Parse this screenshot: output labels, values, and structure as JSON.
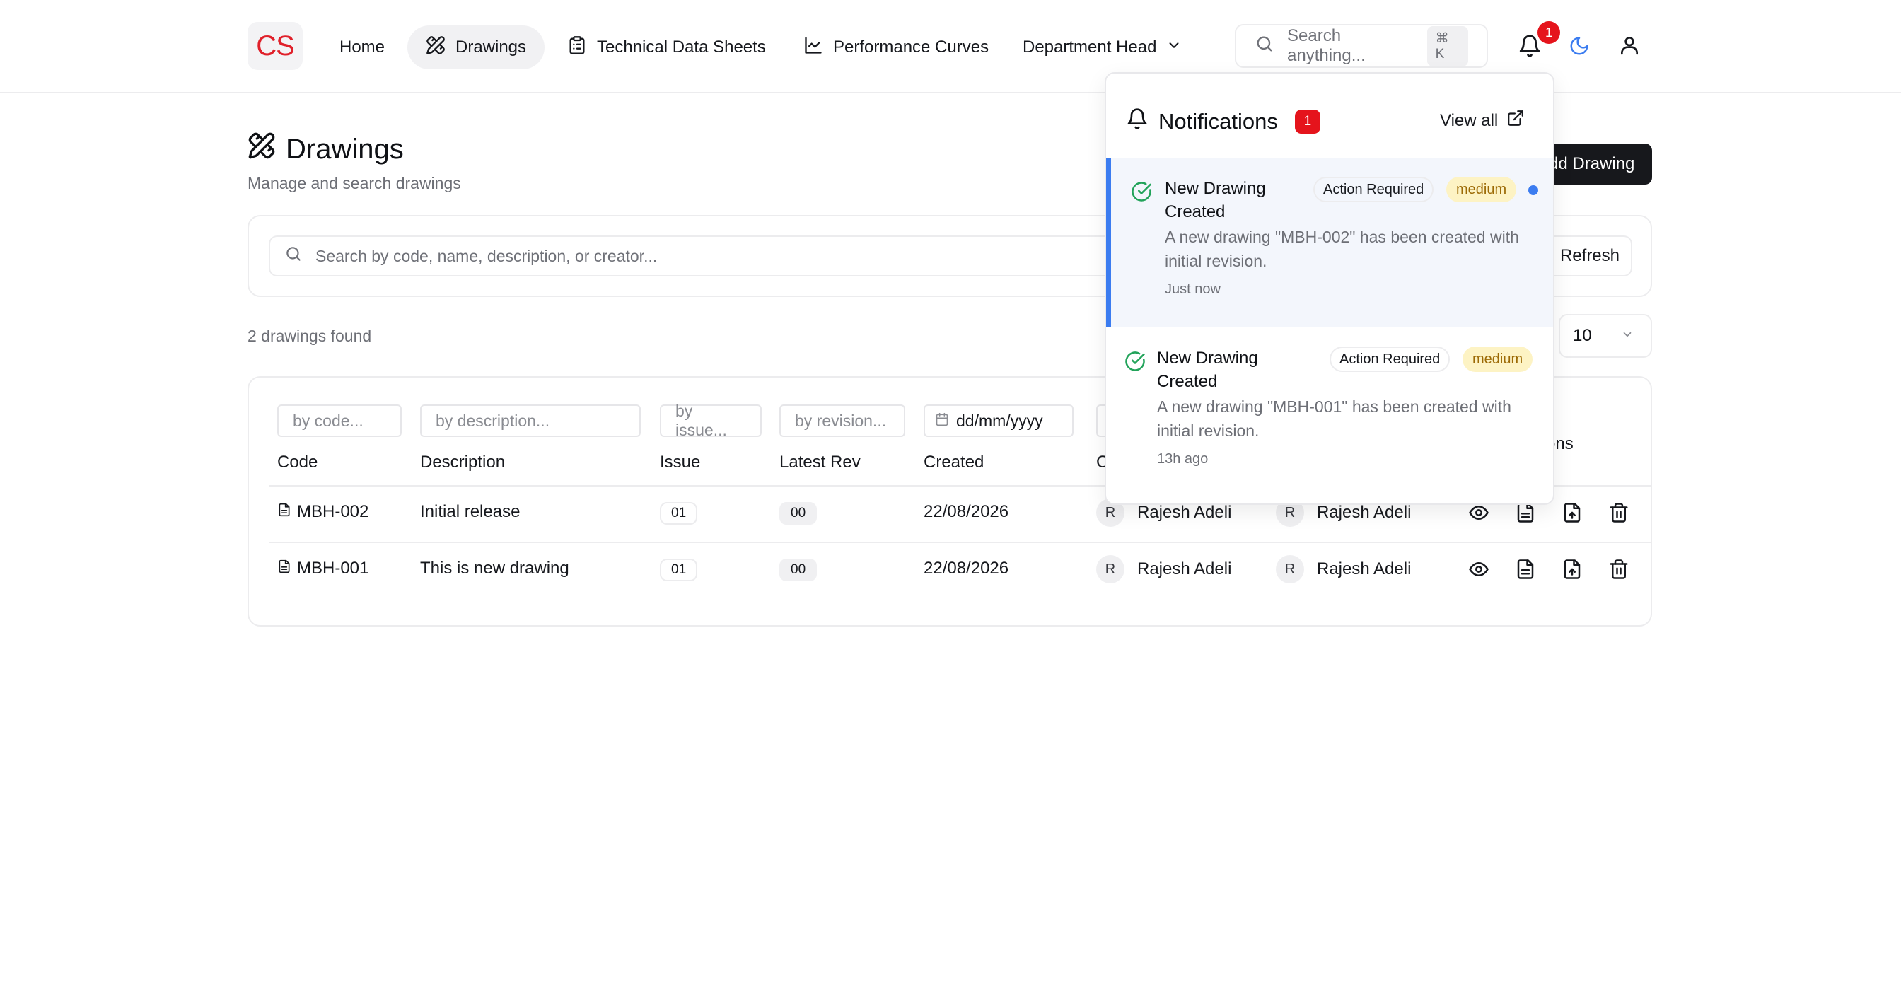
{
  "header": {
    "logo": "CS",
    "nav": [
      {
        "label": "Home"
      },
      {
        "label": "Drawings"
      },
      {
        "label": "Technical Data Sheets"
      },
      {
        "label": "Performance Curves"
      },
      {
        "label": "Department Head"
      }
    ],
    "search_placeholder": "Search anything...",
    "search_shortcut": "⌘ K",
    "notification_count": "1"
  },
  "page": {
    "title": "Drawings",
    "subtitle": "Manage and search drawings",
    "add_button": "dd Drawing",
    "search_placeholder": "Search by code, name, description, or creator...",
    "refresh_button": "Refresh",
    "results_count": "2 drawings found",
    "page_size": "10"
  },
  "table": {
    "filters": {
      "code": "by code...",
      "description": "by description...",
      "issue": "by issue...",
      "revision": "by revision...",
      "created": "dd/mm/yyyy"
    },
    "headers": {
      "code": "Code",
      "description": "Description",
      "issue": "Issue",
      "latest_rev": "Latest Rev",
      "created": "Created",
      "created_by": "C",
      "actions": "ons"
    },
    "rows": [
      {
        "code": "MBH-002",
        "description": "Initial release",
        "issue": "01",
        "latest_rev": "00",
        "created": "22/08/2026",
        "creator_initial": "R",
        "creator": "Rajesh Adeli",
        "updater_initial": "R",
        "updater": "Rajesh Adeli"
      },
      {
        "code": "MBH-001",
        "description": "This is new drawing",
        "issue": "01",
        "latest_rev": "00",
        "created": "22/08/2026",
        "creator_initial": "R",
        "creator": "Rajesh Adeli",
        "updater_initial": "R",
        "updater": "Rajesh Adeli"
      }
    ]
  },
  "notifications": {
    "title": "Notifications",
    "count": "1",
    "view_all": "View all",
    "items": [
      {
        "title": "New Drawing Created",
        "tag": "Action Required",
        "priority": "medium",
        "message": "A new drawing \"MBH-002\" has been created with initial revision.",
        "time": "Just now",
        "unread": true
      },
      {
        "title": "New Drawing Created",
        "tag": "Action Required",
        "priority": "medium",
        "message": "A new drawing \"MBH-001\" has been created with initial revision.",
        "time": "13h ago",
        "unread": false
      }
    ]
  },
  "colors": {
    "brand_red": "#e0202a",
    "badge_red": "#e5141c",
    "accent_blue": "#3b7cf0",
    "success_green": "#22a35a",
    "priority_bg": "#fdf3c4",
    "priority_text": "#9c6a05"
  },
  "icons": {
    "nav_drawings": "pencil-ruler-icon",
    "nav_tds": "clipboard-icon",
    "nav_curves": "line-chart-icon",
    "search": "search-icon",
    "bell": "bell-icon",
    "theme": "moon-icon",
    "user": "user-icon",
    "view": "eye-icon",
    "document": "file-text-icon",
    "upload": "file-up-icon",
    "delete": "trash-icon",
    "check": "check-circle-icon",
    "external": "external-link-icon"
  }
}
